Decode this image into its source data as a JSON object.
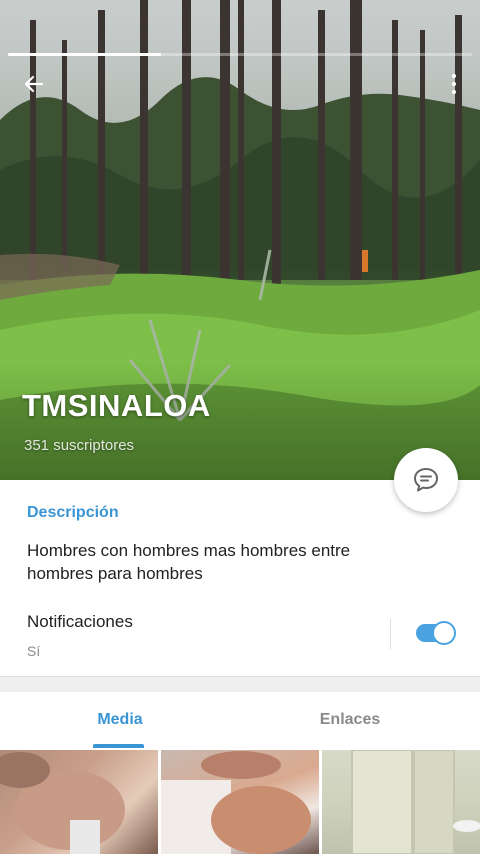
{
  "header": {
    "title": "TMSINALOA",
    "subscribers": "351 suscriptores",
    "story_progress": 0.33,
    "back_icon": "arrow-left-icon",
    "menu_icon": "more-vertical-icon",
    "chat_icon": "chat-bubble-icon"
  },
  "info": {
    "description_label": "Descripción",
    "description_text": "Hombres con hombres mas hombres entre hombres para hombres",
    "notifications_label": "Notificaciones",
    "notifications_value": "Sí",
    "notifications_enabled": true
  },
  "tabs": [
    {
      "label": "Media",
      "active": true
    },
    {
      "label": "Enlaces",
      "active": false
    }
  ],
  "colors": {
    "accent": "#3a95d5",
    "toggle": "#4aa3e0",
    "text": "#222222",
    "muted": "#8a8a8a"
  }
}
